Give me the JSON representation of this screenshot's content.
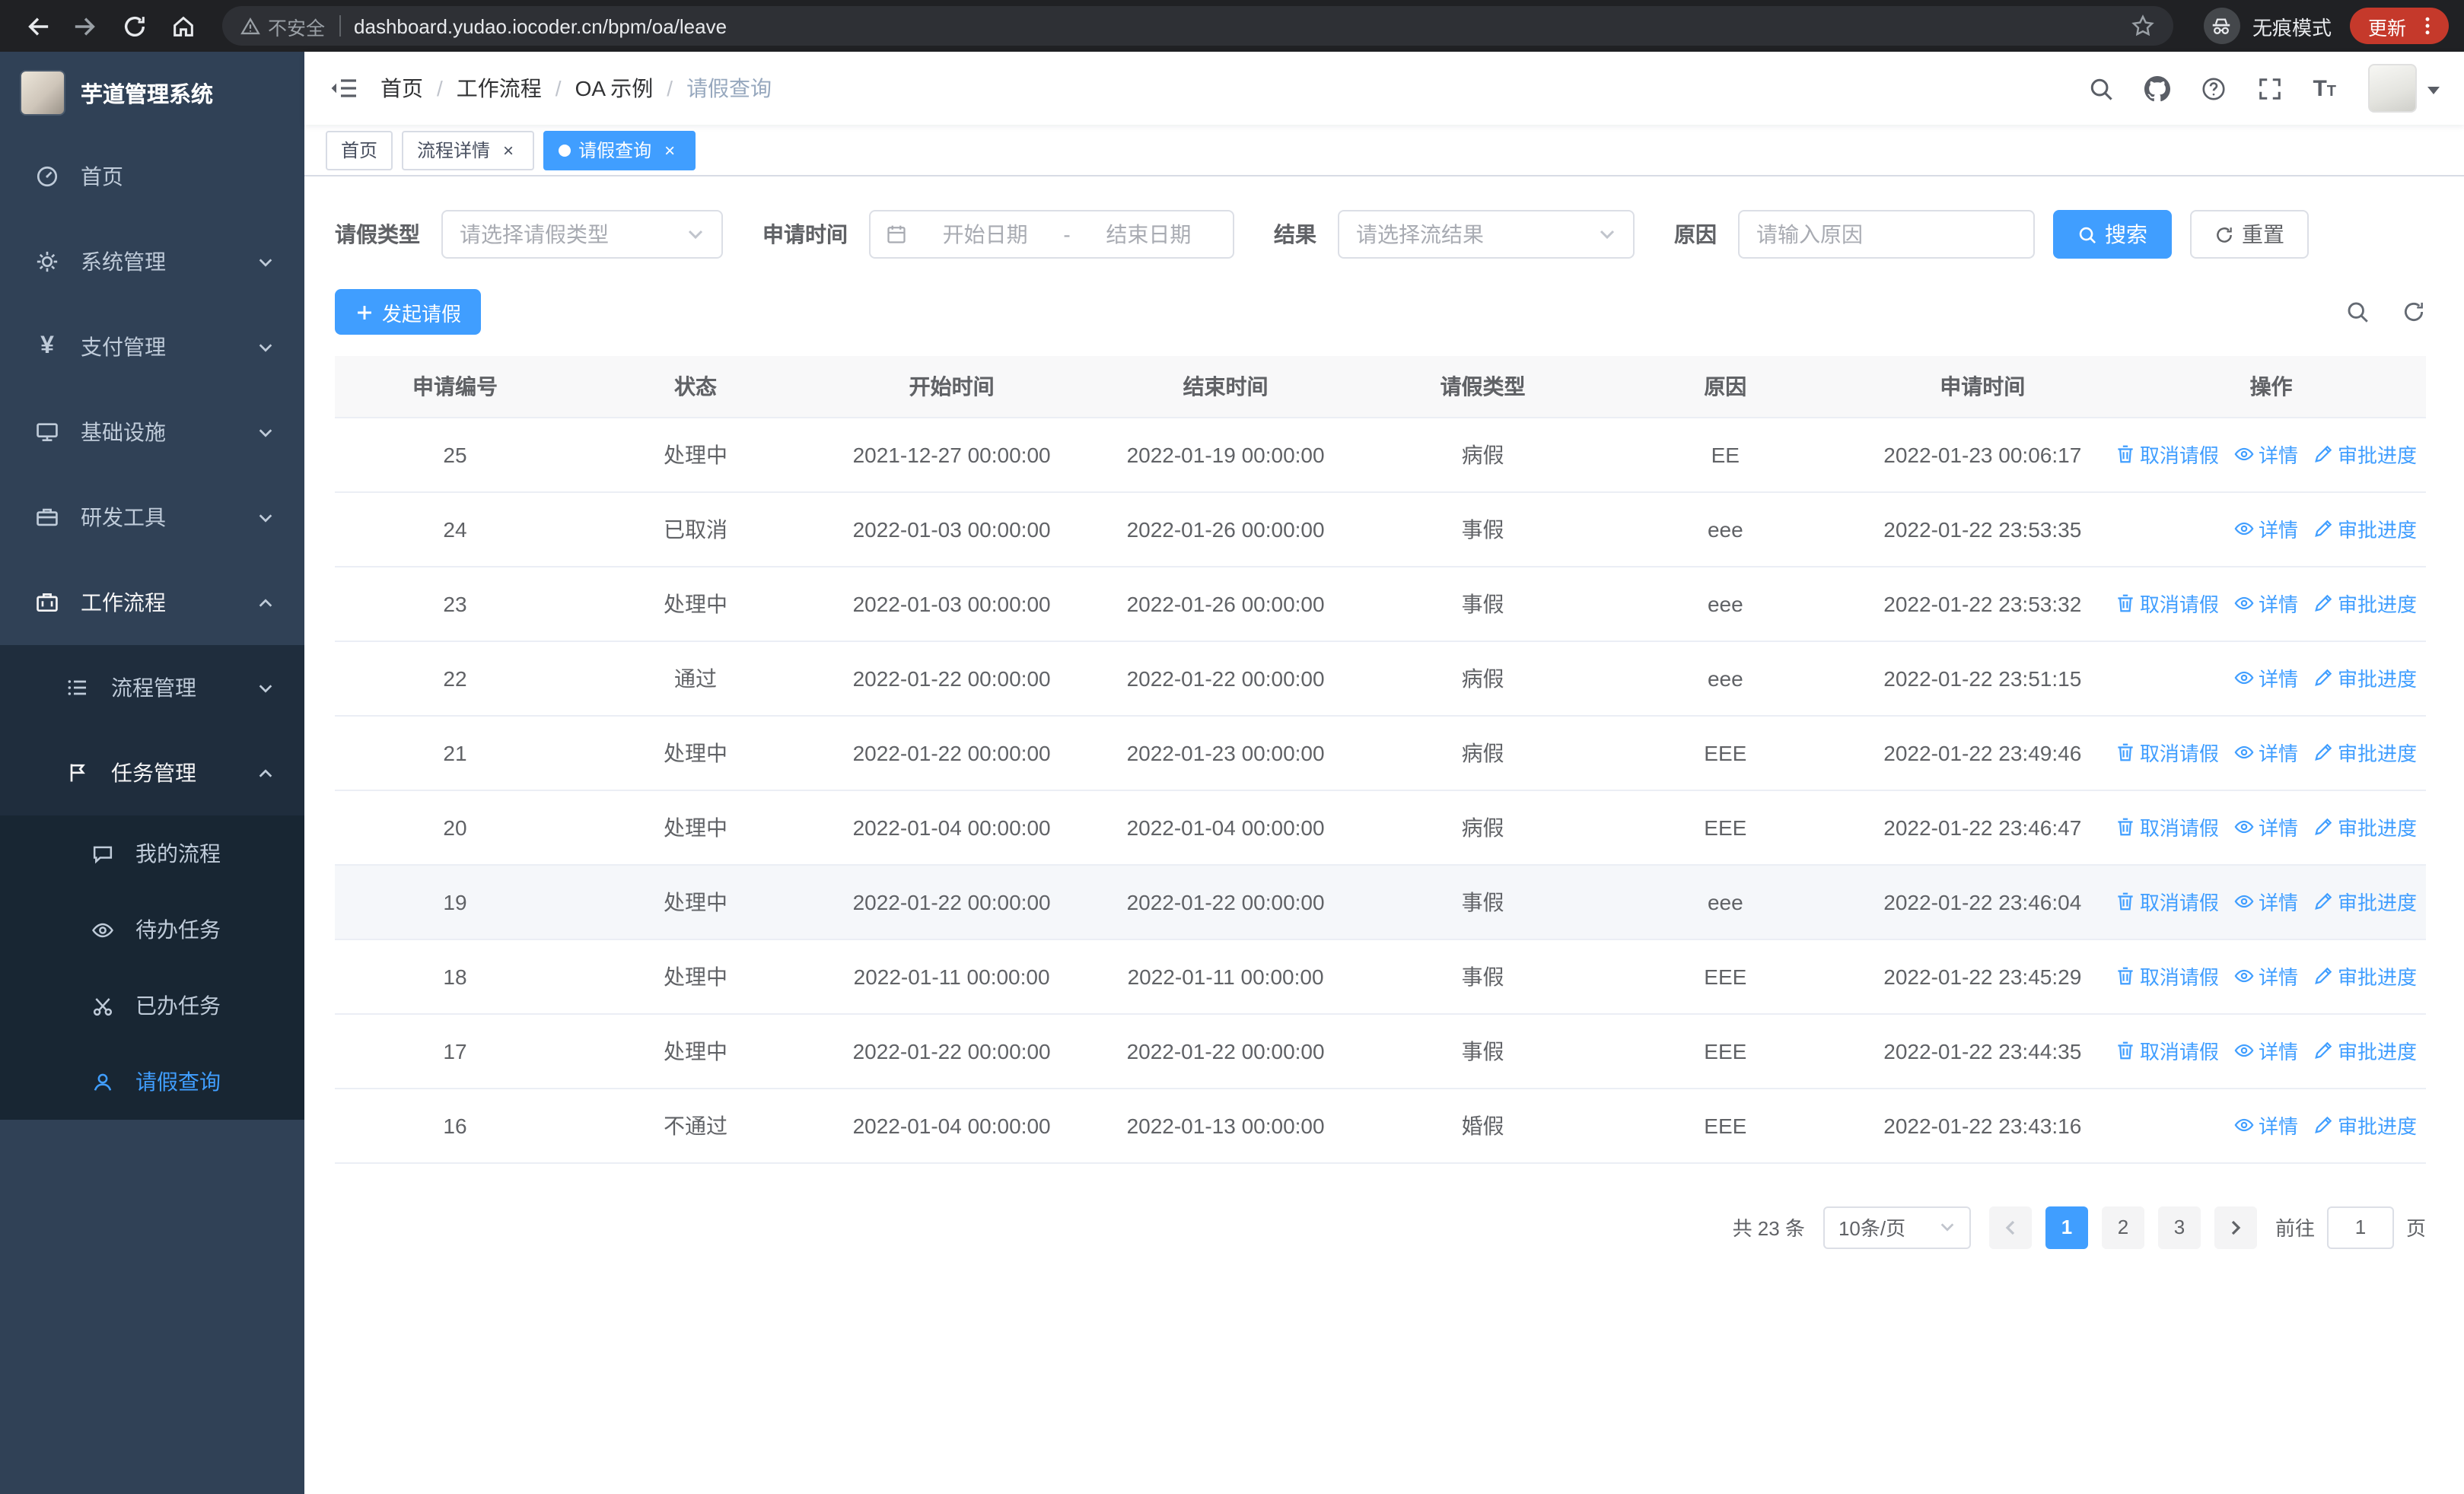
{
  "browser": {
    "security_warning": "不安全",
    "url": "dashboard.yudao.iocoder.cn/bpm/oa/leave",
    "incognito_label": "无痕模式",
    "update_label": "更新"
  },
  "sidebar": {
    "title": "芋道管理系统",
    "menu": [
      {
        "label": "首页"
      },
      {
        "label": "系统管理"
      },
      {
        "label": "支付管理"
      },
      {
        "label": "基础设施"
      },
      {
        "label": "研发工具"
      },
      {
        "label": "工作流程",
        "children": [
          {
            "label": "流程管理"
          },
          {
            "label": "任务管理",
            "children": [
              {
                "label": "我的流程"
              },
              {
                "label": "待办任务"
              },
              {
                "label": "已办任务"
              },
              {
                "label": "请假查询",
                "active": true
              }
            ]
          }
        ]
      }
    ]
  },
  "header": {
    "breadcrumb": [
      "首页",
      "工作流程",
      "OA 示例",
      "请假查询"
    ]
  },
  "tabs": [
    {
      "label": "首页",
      "closable": false,
      "active": false
    },
    {
      "label": "流程详情",
      "closable": true,
      "active": false
    },
    {
      "label": "请假查询",
      "closable": true,
      "active": true
    }
  ],
  "filters": {
    "leave_type_label": "请假类型",
    "leave_type_placeholder": "请选择请假类型",
    "apply_time_label": "申请时间",
    "start_date_placeholder": "开始日期",
    "range_separator": "-",
    "end_date_placeholder": "结束日期",
    "result_label": "结果",
    "result_placeholder": "请选择流结果",
    "reason_label": "原因",
    "reason_placeholder": "请输入原因",
    "search_label": "搜索",
    "reset_label": "重置"
  },
  "toolbar": {
    "create_label": "发起请假"
  },
  "table": {
    "columns": [
      "申请编号",
      "状态",
      "开始时间",
      "结束时间",
      "请假类型",
      "原因",
      "申请时间",
      "操作"
    ],
    "actions": {
      "cancel": "取消请假",
      "detail": "详情",
      "progress": "审批进度"
    },
    "rows": [
      {
        "id": "25",
        "status": "处理中",
        "start": "2021-12-27 00:00:00",
        "end": "2022-01-19 00:00:00",
        "type": "病假",
        "reason": "EE",
        "applied": "2022-01-23 00:06:17",
        "cancellable": true
      },
      {
        "id": "24",
        "status": "已取消",
        "start": "2022-01-03 00:00:00",
        "end": "2022-01-26 00:00:00",
        "type": "事假",
        "reason": "eee",
        "applied": "2022-01-22 23:53:35",
        "cancellable": false
      },
      {
        "id": "23",
        "status": "处理中",
        "start": "2022-01-03 00:00:00",
        "end": "2022-01-26 00:00:00",
        "type": "事假",
        "reason": "eee",
        "applied": "2022-01-22 23:53:32",
        "cancellable": true
      },
      {
        "id": "22",
        "status": "通过",
        "start": "2022-01-22 00:00:00",
        "end": "2022-01-22 00:00:00",
        "type": "病假",
        "reason": "eee",
        "applied": "2022-01-22 23:51:15",
        "cancellable": false
      },
      {
        "id": "21",
        "status": "处理中",
        "start": "2022-01-22 00:00:00",
        "end": "2022-01-23 00:00:00",
        "type": "病假",
        "reason": "EEE",
        "applied": "2022-01-22 23:49:46",
        "cancellable": true
      },
      {
        "id": "20",
        "status": "处理中",
        "start": "2022-01-04 00:00:00",
        "end": "2022-01-04 00:00:00",
        "type": "病假",
        "reason": "EEE",
        "applied": "2022-01-22 23:46:47",
        "cancellable": true
      },
      {
        "id": "19",
        "status": "处理中",
        "start": "2022-01-22 00:00:00",
        "end": "2022-01-22 00:00:00",
        "type": "事假",
        "reason": "eee",
        "applied": "2022-01-22 23:46:04",
        "cancellable": true,
        "hovered": true
      },
      {
        "id": "18",
        "status": "处理中",
        "start": "2022-01-11 00:00:00",
        "end": "2022-01-11 00:00:00",
        "type": "事假",
        "reason": "EEE",
        "applied": "2022-01-22 23:45:29",
        "cancellable": true
      },
      {
        "id": "17",
        "status": "处理中",
        "start": "2022-01-22 00:00:00",
        "end": "2022-01-22 00:00:00",
        "type": "事假",
        "reason": "EEE",
        "applied": "2022-01-22 23:44:35",
        "cancellable": true
      },
      {
        "id": "16",
        "status": "不通过",
        "start": "2022-01-04 00:00:00",
        "end": "2022-01-13 00:00:00",
        "type": "婚假",
        "reason": "EEE",
        "applied": "2022-01-22 23:43:16",
        "cancellable": false
      }
    ]
  },
  "pagination": {
    "total_text": "共 23 条",
    "page_size": "10条/页",
    "pages": [
      {
        "label": "1",
        "active": true
      },
      {
        "label": "2",
        "active": false
      },
      {
        "label": "3",
        "active": false
      }
    ],
    "goto_label": "前往",
    "goto_value": "1",
    "page_unit": "页"
  },
  "colors": {
    "primary": "#409eff"
  }
}
